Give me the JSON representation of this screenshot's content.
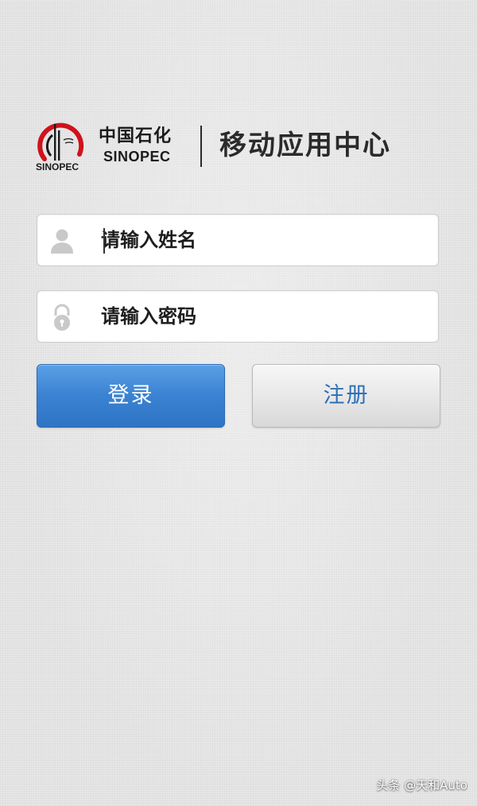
{
  "brand": {
    "logo_icon": "sinopec-logo-icon",
    "logo_mark_text": "SINOPEC",
    "name_cn": "中国石化",
    "name_en": "SINOPEC",
    "app_title": "移动应用中心"
  },
  "form": {
    "username": {
      "icon": "user-icon",
      "value": "",
      "placeholder": "请输入姓名"
    },
    "password": {
      "icon": "lock-icon",
      "value": "",
      "placeholder": "请输入密码"
    }
  },
  "actions": {
    "login_label": "登录",
    "register_label": "注册"
  },
  "watermark": {
    "text": "头条 @天和Auto"
  },
  "colors": {
    "background": "#e6e6e6",
    "primary_button": "#3a82d2",
    "secondary_button": "#e7e7e7",
    "register_text": "#2e6fb7",
    "logo_red": "#d0121b"
  }
}
